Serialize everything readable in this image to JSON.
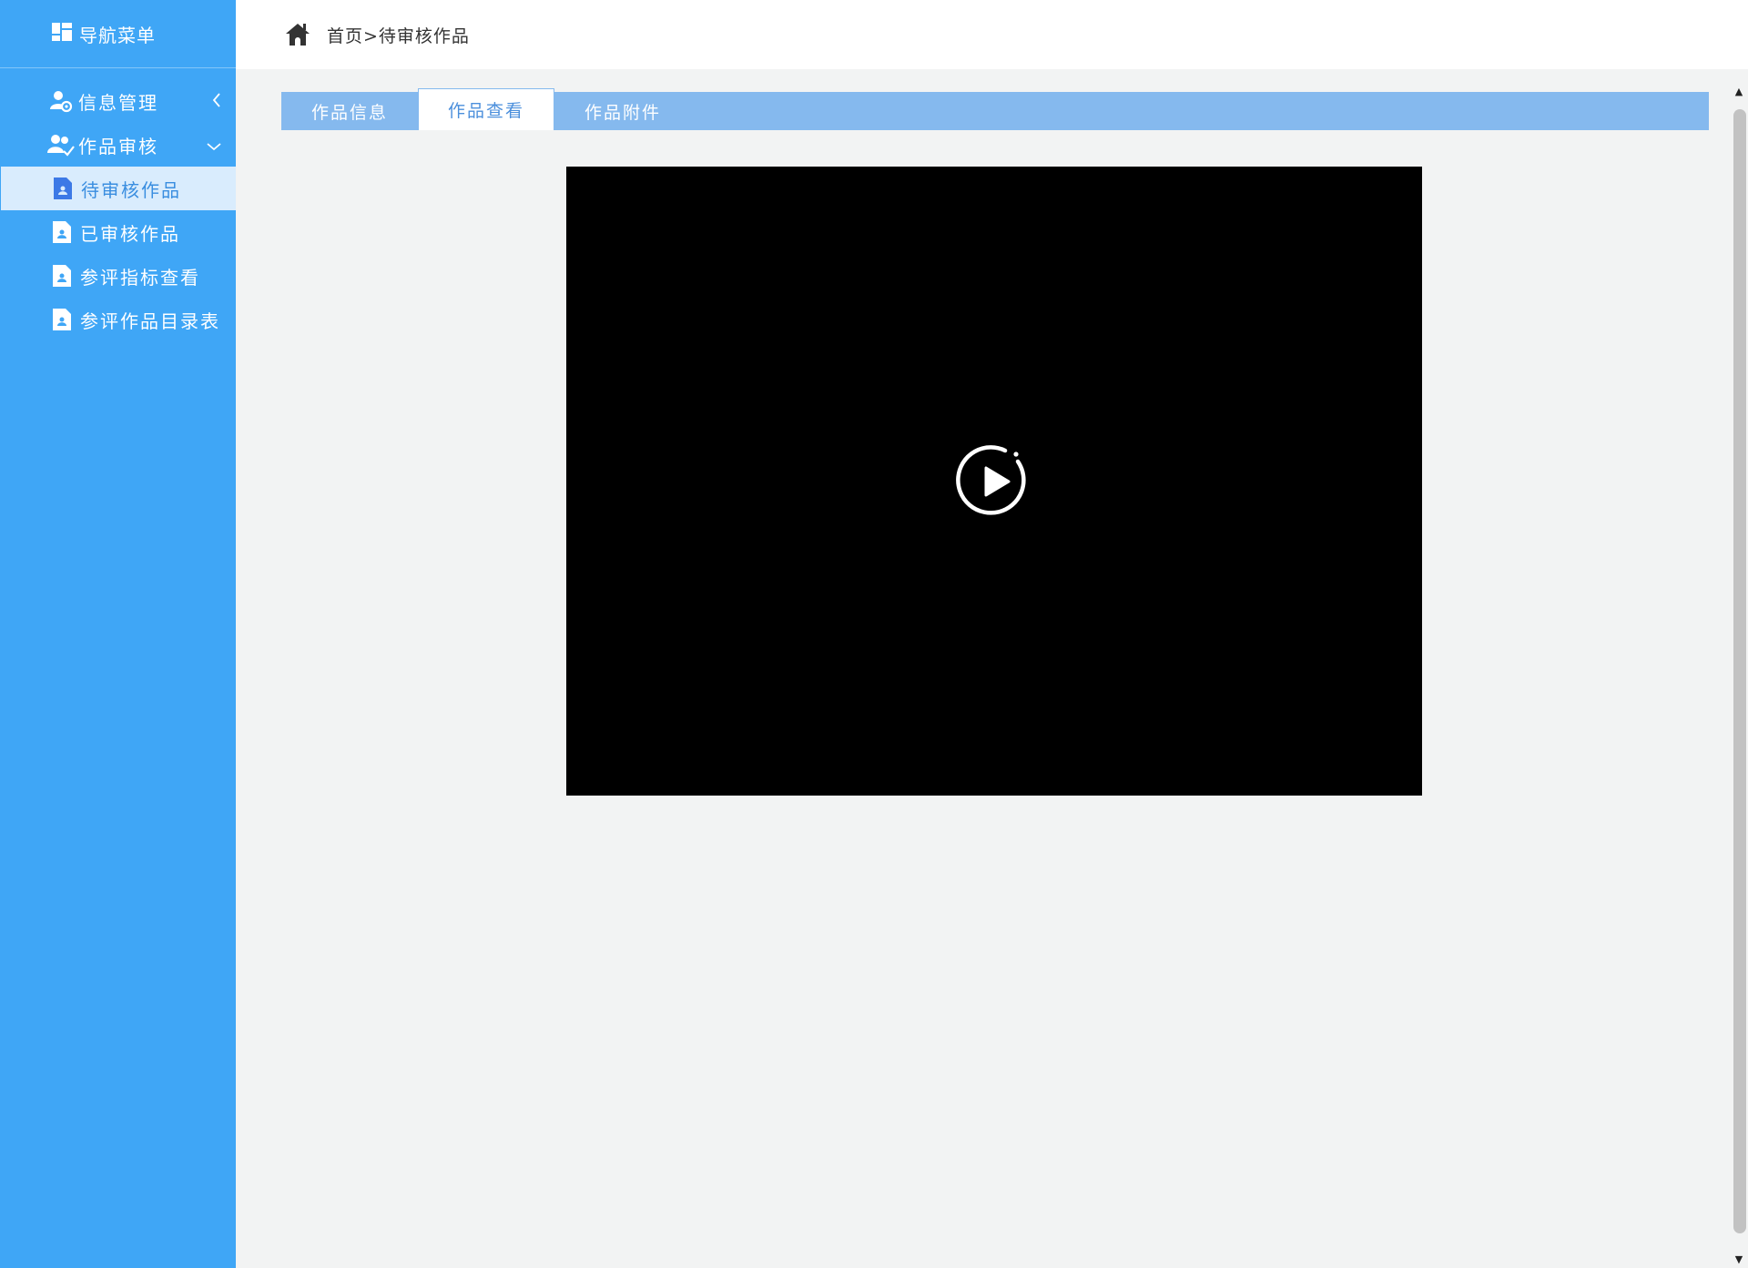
{
  "sidebar": {
    "title": "导航菜单",
    "title_icon": "dashboard-icon",
    "groups": [
      {
        "label": "信息管理",
        "icon": "user-gear-icon",
        "chevron": "chevron-left-icon",
        "expanded": false
      },
      {
        "label": "作品审核",
        "icon": "user-check-icon",
        "chevron": "chevron-down-icon",
        "expanded": true
      }
    ],
    "items": [
      {
        "label": "待审核作品",
        "icon": "document-user-icon",
        "active": true
      },
      {
        "label": "已审核作品",
        "icon": "document-user-icon",
        "active": false
      },
      {
        "label": "参评指标查看",
        "icon": "document-user-icon",
        "active": false
      },
      {
        "label": "参评作品目录表",
        "icon": "document-user-icon",
        "active": false
      }
    ]
  },
  "header": {
    "home_icon": "home-icon",
    "breadcrumb": "首页>待审核作品"
  },
  "tabs": [
    {
      "label": "作品信息",
      "active": false
    },
    {
      "label": "作品查看",
      "active": true
    },
    {
      "label": "作品附件",
      "active": false
    }
  ],
  "video": {
    "play_icon": "play-circle-icon"
  },
  "colors": {
    "sidebar_bg": "#3fa6f6",
    "active_item_bg": "#d9ecfd",
    "active_item_text": "#3a8ee0",
    "tabbar_bg": "#85b9ee",
    "main_bg": "#f2f3f3"
  }
}
